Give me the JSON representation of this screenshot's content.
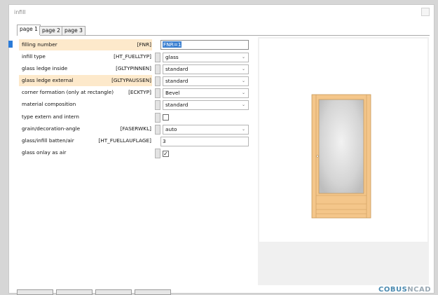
{
  "window": {
    "title": "infill"
  },
  "tabs": [
    {
      "label": "page 1",
      "active": true
    },
    {
      "label": "page 2",
      "active": false
    },
    {
      "label": "page 3",
      "active": false
    }
  ],
  "rows": [
    {
      "label": "filling number",
      "code": "[FNR]",
      "highlight": true,
      "control": "text",
      "value": "FNR=1"
    },
    {
      "label": "infill type",
      "code": "[HT_FUELLTYP]",
      "control": "select",
      "value": "glass"
    },
    {
      "label": "glass ledge inside",
      "code": "[GLTYPINNEN]",
      "control": "select",
      "value": "standard"
    },
    {
      "label": "glass ledge external",
      "code": "[GLTYPAUSSEN]",
      "highlight": true,
      "control": "select",
      "value": "standard"
    },
    {
      "label": "corner formation (only at rectangle)",
      "code": "[ECKTYP]",
      "control": "select",
      "value": "Bevel"
    },
    {
      "label": "material composition",
      "code": "",
      "control": "select",
      "value": "standard"
    },
    {
      "label": "type extern and intern",
      "code": "",
      "control": "checkbox",
      "checked": false
    },
    {
      "label": "grain/decoration-angle",
      "code": "[FASERWKL]",
      "control": "select",
      "value": "auto"
    },
    {
      "label": "glass/infill batten/air",
      "code": "[HT_FUELLAUFLAGE]",
      "control": "text",
      "value": "3"
    },
    {
      "label": "glass onlay as air",
      "code": "",
      "control": "checkbox",
      "checked": true
    }
  ],
  "icons": {
    "checkmark": "✓",
    "dropdown": "chevron-down"
  },
  "logo": {
    "part1": "COBUS",
    "part2": "NCAD"
  },
  "colors": {
    "highlight": "#fde9cb",
    "accent": "#3a7fd0",
    "frame_wood": "#f4c68a"
  }
}
